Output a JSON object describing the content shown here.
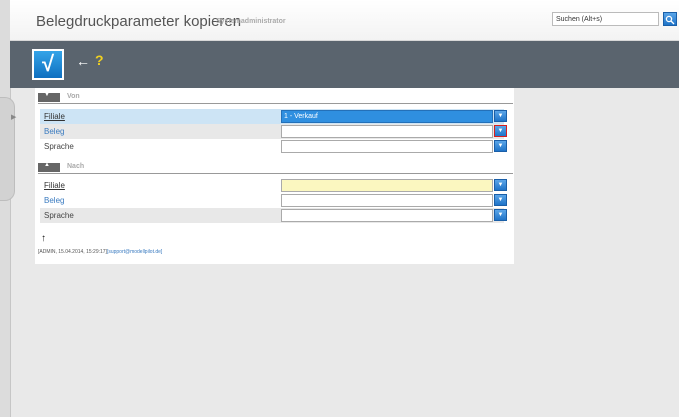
{
  "header": {
    "title": "Belegdruckparameter kopieren",
    "subtitle": "Systemadministrator",
    "search_placeholder": "Suchen (Alt+s)"
  },
  "toolbar": {
    "confirm_icon": "checkmark-icon",
    "confirm_glyph": "√",
    "back_glyph": "←",
    "help_glyph": "?"
  },
  "sections": {
    "von": {
      "label": "Von",
      "rows": [
        {
          "label": "Filiale",
          "value": "1 - Verkauf"
        },
        {
          "label": "Beleg",
          "value": ""
        },
        {
          "label": "Sprache",
          "value": ""
        }
      ]
    },
    "nach": {
      "label": "Nach",
      "rows": [
        {
          "label": "Filiale",
          "value": ""
        },
        {
          "label": "Beleg",
          "value": ""
        },
        {
          "label": "Sprache",
          "value": ""
        }
      ]
    }
  },
  "footer": {
    "info": "[ADMIN, 15.04.2014, 15:29:17]",
    "email": "[support@modellpilot.de]"
  },
  "colors": {
    "accent": "#1f74c8",
    "toolbar_bg": "#5a646e",
    "highlight_row": "#cde4f5",
    "required_field": "#fbf7c0",
    "focus_border": "#d81e1e"
  }
}
